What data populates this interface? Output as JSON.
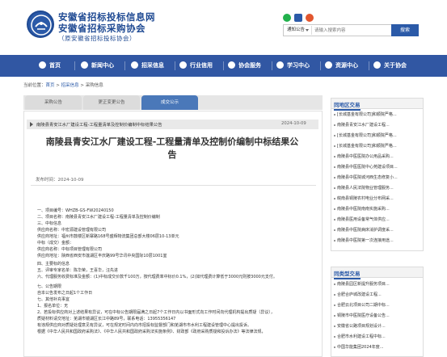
{
  "site": {
    "title_line1": "安徽省招标投标信息网",
    "title_line2": "安徽省招标采购协会",
    "subtitle": "（原安徽省招标投标协会）"
  },
  "search": {
    "select_value": "通知公告",
    "placeholder": "请输入搜索内容",
    "button_label": "搜索"
  },
  "nav": {
    "items": [
      {
        "label": "首页",
        "icon": "home-icon"
      },
      {
        "label": "新闻中心",
        "icon": "news-icon"
      },
      {
        "label": "招采信息",
        "icon": "info-icon"
      },
      {
        "label": "行业信用",
        "icon": "credit-icon"
      },
      {
        "label": "协会服务",
        "icon": "service-icon"
      },
      {
        "label": "学习中心",
        "icon": "study-icon"
      },
      {
        "label": "资源中心",
        "icon": "resource-icon"
      },
      {
        "label": "关于协会",
        "icon": "about-icon"
      }
    ]
  },
  "breadcrumb": {
    "prefix": "当前位置：",
    "home": "首页",
    "sep1": " > ",
    "level2": "招采信息",
    "sep2": " > ",
    "current": "采购信息"
  },
  "tabs": [
    {
      "label": "采购公告"
    },
    {
      "label": "更正变更公告"
    },
    {
      "label": "成交公示"
    }
  ],
  "notice": {
    "text": "南陵县青安江水厂建设工程-工程量清单及控制价编制中标结果公告",
    "date": "2024-10-09"
  },
  "article": {
    "title_line1": "南陵县青安江水厂建设工程-工程量清单及控制价编制中标结果公",
    "title_line2": "告",
    "publish_date": "发布时间：2024-10-09",
    "lines": [
      "一、项目编号：WHZB-GS-FW20240150",
      "二、项目名称：南陵县青安江水厂建设工程-工程量清单及控制价编制",
      "三、中标信息",
      "供应商名称：中宏源建设管理有限公司",
      "供应商地址：福州市鼓楼区新寨路168号盛辉物流集团总部大楼06层10-13单元",
      "中标（成交）金额：",
      "供应商名称：中标项目管理有限公司",
      "供应商地址：陕西省西安市莲湖区丰庆路99号华讯中央国际10层1001室",
      "四、主要标的信息",
      "五、评审专家名单：陈华荣，王喜华，汪先进",
      "六、代理服务收费标准及金额：(1)中标成交价款千100万，按代理费率中标价0.1%，(2)如代理费计算低于3000元则按3000元支付。",
      "七、公告期限",
      "自本公告发布之日起1个工作日",
      "七、其他补充事宜",
      "1、报名单位：无",
      "2、若投标供应商对上述结果有异议，可在中标公告期限届满之日起7个工作日内以书面形式向工作时间向代理机构提出质疑（异议），",
      "质疑材料请交地址：芜湖市镜湖区长江中路89号，联系电话：13955356147",
      "有违规供应商对质疑处理意见有异议，可在规定时间内向市招投标监督部门和芜湖市市水利工程建设管理中心提出投诉。",
      "根据《中华人民共和国政府采购法》、《中华人民共和国政府采购法实施条例》、财政部《政府采购质疑和投诉办法》等法律法规，"
    ]
  },
  "sidebar": {
    "same_org_title": "同地区交易",
    "same_org_items": [
      "[长城基金有限公司]和顺院严格...",
      "南陵县青安江水厂建设工程...",
      "[长城基金有限公司]和顺院严格...",
      "[长城基金有限公司]和顺院严格...",
      "南陵县中医医院办公用品采购...",
      "南陵县中医医院中心苑建设项目...",
      "南陵县中医院城河西生态修复小...",
      "南陵县人民法院物业管理服务...",
      "皖南县铜陵农村电业分布网采...",
      "南陵县中医院南南实施采购...",
      "南陵县医用设备常气体供应...",
      "南陵县中医院病床消护调度采...",
      "南陵县中医院第一次连接用途..."
    ],
    "same_type_title": "同类型交易",
    "same_type_items": [
      "南陵县园区新提升服务项目...",
      "合肥合庐城改建设工程...",
      "合肥云北项目公司二期中标...",
      "铜陵市中医院医疗设备公告...",
      "安徽省公路项目规划设计...",
      "合肥市水利建设工程中标...",
      "中国华能集团2024年度..."
    ]
  },
  "colors": {
    "brand": "#3157a3",
    "accent": "#2b5aa8",
    "tab_active": "#4a78b9"
  }
}
